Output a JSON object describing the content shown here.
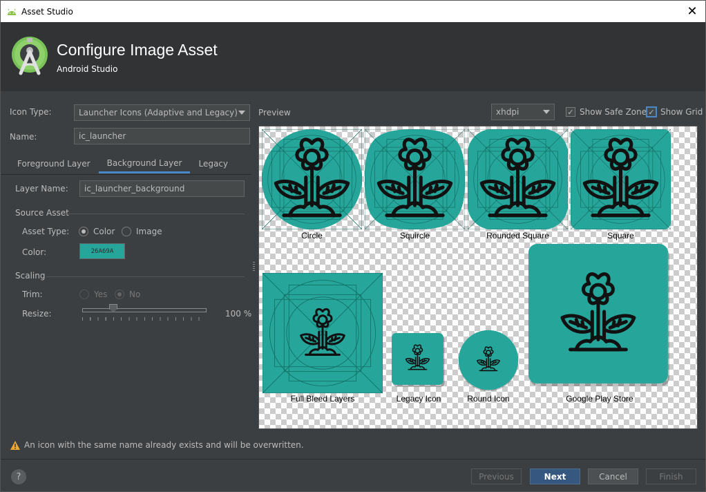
{
  "window": {
    "title": "Asset Studio"
  },
  "header": {
    "title": "Configure Image Asset",
    "subtitle": "Android Studio"
  },
  "form": {
    "icon_type_label": "Icon Type:",
    "icon_type_value": "Launcher Icons (Adaptive and Legacy)",
    "name_label": "Name:",
    "name_value": "ic_launcher"
  },
  "tabs": [
    {
      "label": "Foreground Layer",
      "active": false
    },
    {
      "label": "Background Layer",
      "active": true
    },
    {
      "label": "Legacy",
      "active": false
    }
  ],
  "layer": {
    "layer_name_label": "Layer Name:",
    "layer_name_value": "ic_launcher_background",
    "source_asset_heading": "Source Asset",
    "asset_type_label": "Asset Type:",
    "asset_type_options": [
      "Color",
      "Image"
    ],
    "asset_type_selected": "Color",
    "color_label": "Color:",
    "color_value": "26A69A",
    "scaling_heading": "Scaling",
    "trim_label": "Trim:",
    "trim_options": [
      "Yes",
      "No"
    ],
    "trim_selected": "No",
    "resize_label": "Resize:",
    "resize_value": "100 %",
    "resize_slider_fraction": 0.25
  },
  "preview": {
    "label": "Preview",
    "density_value": "xhdpi",
    "show_safe_zone_label": "Show Safe Zone",
    "show_safe_zone_checked": true,
    "show_grid_label": "Show Grid",
    "show_grid_checked": true,
    "icons": [
      {
        "label": "Circle",
        "shape": "circle"
      },
      {
        "label": "Squircle",
        "shape": "squircle"
      },
      {
        "label": "Rounded Square",
        "shape": "rounded-square"
      },
      {
        "label": "Square",
        "shape": "square"
      },
      {
        "label": "Full Bleed Layers",
        "shape": "full-bleed"
      },
      {
        "label": "Legacy Icon",
        "shape": "legacy"
      },
      {
        "label": "Round Icon",
        "shape": "round"
      },
      {
        "label": "Google Play Store",
        "shape": "play-store"
      }
    ],
    "icon_color": "#26a69a"
  },
  "warning": {
    "text": "An icon with the same name already exists and will be overwritten."
  },
  "buttons": {
    "previous": "Previous",
    "next": "Next",
    "cancel": "Cancel",
    "finish": "Finish",
    "help": "?"
  }
}
